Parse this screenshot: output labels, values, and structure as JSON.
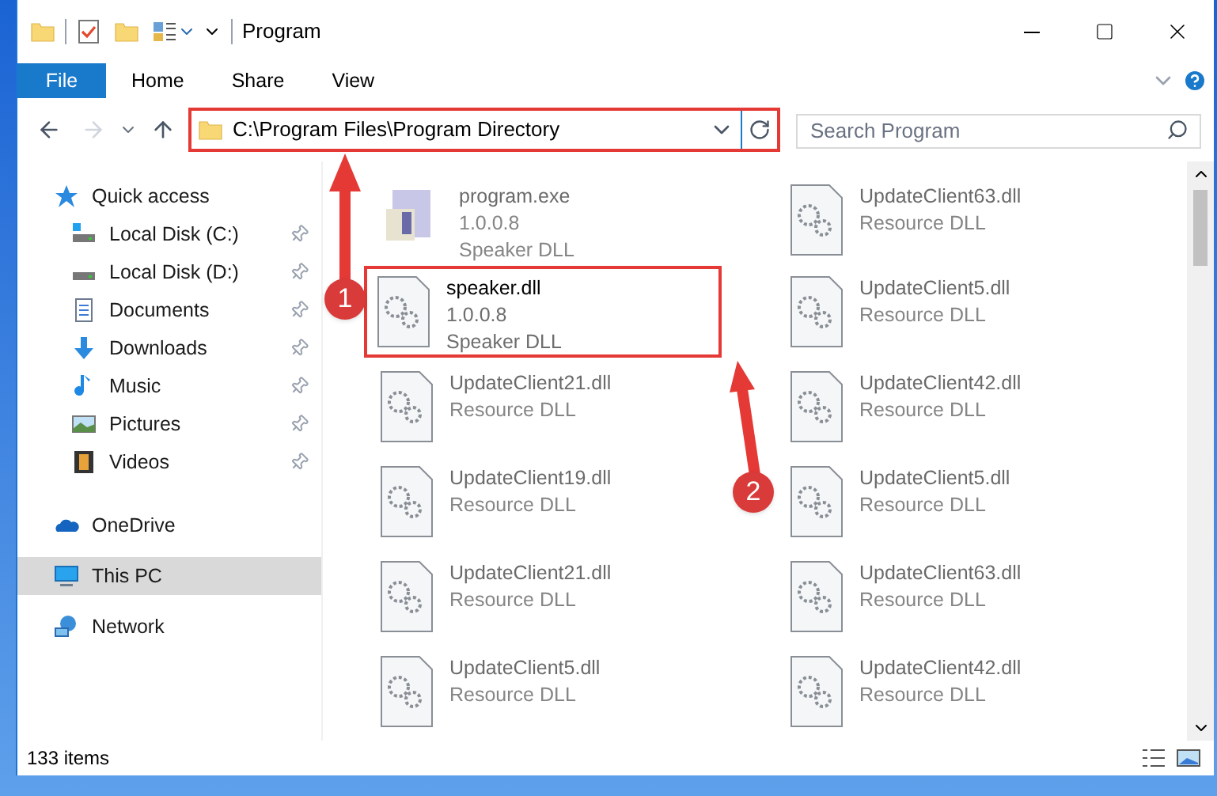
{
  "window": {
    "title": "Program"
  },
  "ribbon": {
    "file_button": "File",
    "tabs": [
      "Home",
      "Share",
      "View"
    ]
  },
  "address_bar": {
    "path": "C:\\Program Files\\Program Directory",
    "highlighted": true
  },
  "search": {
    "placeholder": "Search Program"
  },
  "sidebar": {
    "items": [
      {
        "label": "Quick access",
        "kind": "quick-access",
        "selected": false,
        "children": [
          {
            "label": "Local Disk (C:)",
            "kind": "system-drive",
            "pinned": true,
            "selected": false
          },
          {
            "label": "Local Disk (D:)",
            "kind": "drive",
            "pinned": true,
            "selected": false
          },
          {
            "label": "Documents",
            "kind": "documents",
            "pinned": true,
            "selected": false
          },
          {
            "label": "Downloads",
            "kind": "downloads",
            "pinned": true,
            "selected": false
          },
          {
            "label": "Music",
            "kind": "music",
            "pinned": true,
            "selected": false
          },
          {
            "label": "Pictures",
            "kind": "pictures",
            "pinned": true,
            "selected": false
          },
          {
            "label": "Videos",
            "kind": "videos",
            "pinned": true,
            "selected": false
          }
        ]
      },
      {
        "label": "OneDrive",
        "kind": "onedrive",
        "selected": false
      },
      {
        "label": "This PC",
        "kind": "pc",
        "selected": true
      },
      {
        "label": "Network",
        "kind": "network",
        "selected": false
      }
    ]
  },
  "files": [
    {
      "name": "program.exe",
      "kind": "exe",
      "version": "1.0.0.8",
      "description": "Speaker DLL",
      "highlighted": false,
      "blurred": true
    },
    {
      "name": "UpdateClient63.dll",
      "kind": "dll",
      "description": "Resource DLL",
      "highlighted": false,
      "blurred": true
    },
    {
      "name": "speaker.dll",
      "kind": "dll",
      "version": "1.0.0.8",
      "description": "Speaker DLL",
      "highlighted": true,
      "blurred": false
    },
    {
      "name": "UpdateClient5.dll",
      "kind": "dll",
      "description": "Resource DLL",
      "highlighted": false,
      "blurred": true
    },
    {
      "name": "UpdateClient21.dll",
      "kind": "dll",
      "description": "Resource DLL",
      "highlighted": false,
      "blurred": true
    },
    {
      "name": "UpdateClient42.dll",
      "kind": "dll",
      "description": "Resource DLL",
      "highlighted": false,
      "blurred": true
    },
    {
      "name": "UpdateClient19.dll",
      "kind": "dll",
      "description": "Resource DLL",
      "highlighted": false,
      "blurred": true
    },
    {
      "name": "UpdateClient5.dll",
      "kind": "dll",
      "description": "Resource DLL",
      "highlighted": false,
      "blurred": true
    },
    {
      "name": "UpdateClient21.dll",
      "kind": "dll",
      "description": "Resource DLL",
      "highlighted": false,
      "blurred": true
    },
    {
      "name": "UpdateClient63.dll",
      "kind": "dll",
      "description": "Resource DLL",
      "highlighted": false,
      "blurred": true
    },
    {
      "name": "UpdateClient5.dll",
      "kind": "dll",
      "description": "Resource DLL",
      "highlighted": false,
      "blurred": true
    },
    {
      "name": "UpdateClient42.dll",
      "kind": "dll",
      "description": "Resource DLL",
      "highlighted": false,
      "blurred": true
    }
  ],
  "annotations": [
    {
      "number": "1"
    },
    {
      "number": "2"
    }
  ],
  "status_bar": {
    "count": "133 items"
  }
}
